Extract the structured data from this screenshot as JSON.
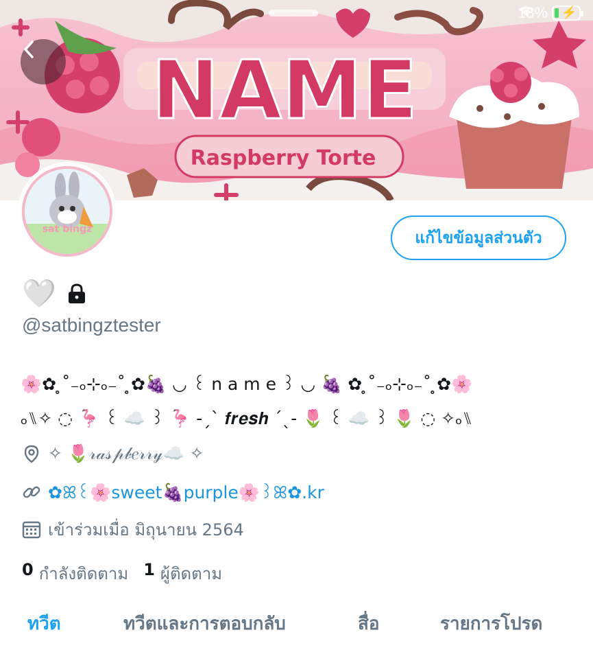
{
  "status_bar": {
    "battery_percent": "18%",
    "battery_level": 0.18,
    "icons": [
      "wifi-icon",
      "battery-charging-icon"
    ]
  },
  "header": {
    "back_icon": "chevron-left-icon",
    "banner": {
      "title_text": "NAME",
      "subtitle_text": "Raspberry Torte",
      "colors": {
        "background": "#f4b6c7",
        "title": "#d23a63",
        "cake": "#c9706a"
      }
    }
  },
  "avatar": {
    "text": "sat bingz"
  },
  "edit_profile_label": "แก้ไขข้อมูลส่วนตัว",
  "profile": {
    "display_name": "🤍",
    "lock_icon": "lock-icon",
    "handle": "@satbingztester",
    "bio_line_1": "🌸✿ ̥˚₋ₒ⊹ₒ₋˚ ̥✿🍇 ◡ ꒰ n a m e ꒱ ◡ 🍇 ✿ ̥˚₋ₒ⊹ₒ₋˚ ̥✿🌸",
    "bio_line_2": "ₒ⑊✧ ◌ 🦩 ꒰ ☁️ ꒱ 🦩 -ˏˋ 𝒇𝒓𝒆𝒔𝒉 ˊˎ- 🌷 ꒰ ☁️ ꒱ 🌷 ◌ ✧ₒ⑊",
    "location": "✧ 🌷𝓇𝒶𝓈𝓅𝒷𝑒𝓇𝓇𝓎☁️ ✧",
    "link": "✿ꕤ꒰🌸sweet🍇purple🌸꒱ꕤ✿.kr",
    "joined": "เข้าร่วมเมื่อ มิถุนายน 2564",
    "following_count": "0",
    "following_label": "กำลังติดตาม",
    "followers_count": "1",
    "followers_label": "ผู้ติดตาม",
    "icons": [
      "location-pin-icon",
      "link-icon",
      "calendar-icon"
    ],
    "colors": {
      "link": "#1b95e0",
      "muted": "#657786",
      "accent": "#1da1f2"
    }
  },
  "tabs": [
    {
      "label": "ทวีต",
      "active": true
    },
    {
      "label": "ทวีตและการตอบกลับ",
      "active": false
    },
    {
      "label": "สื่อ",
      "active": false
    },
    {
      "label": "รายการโปรด",
      "active": false
    }
  ]
}
